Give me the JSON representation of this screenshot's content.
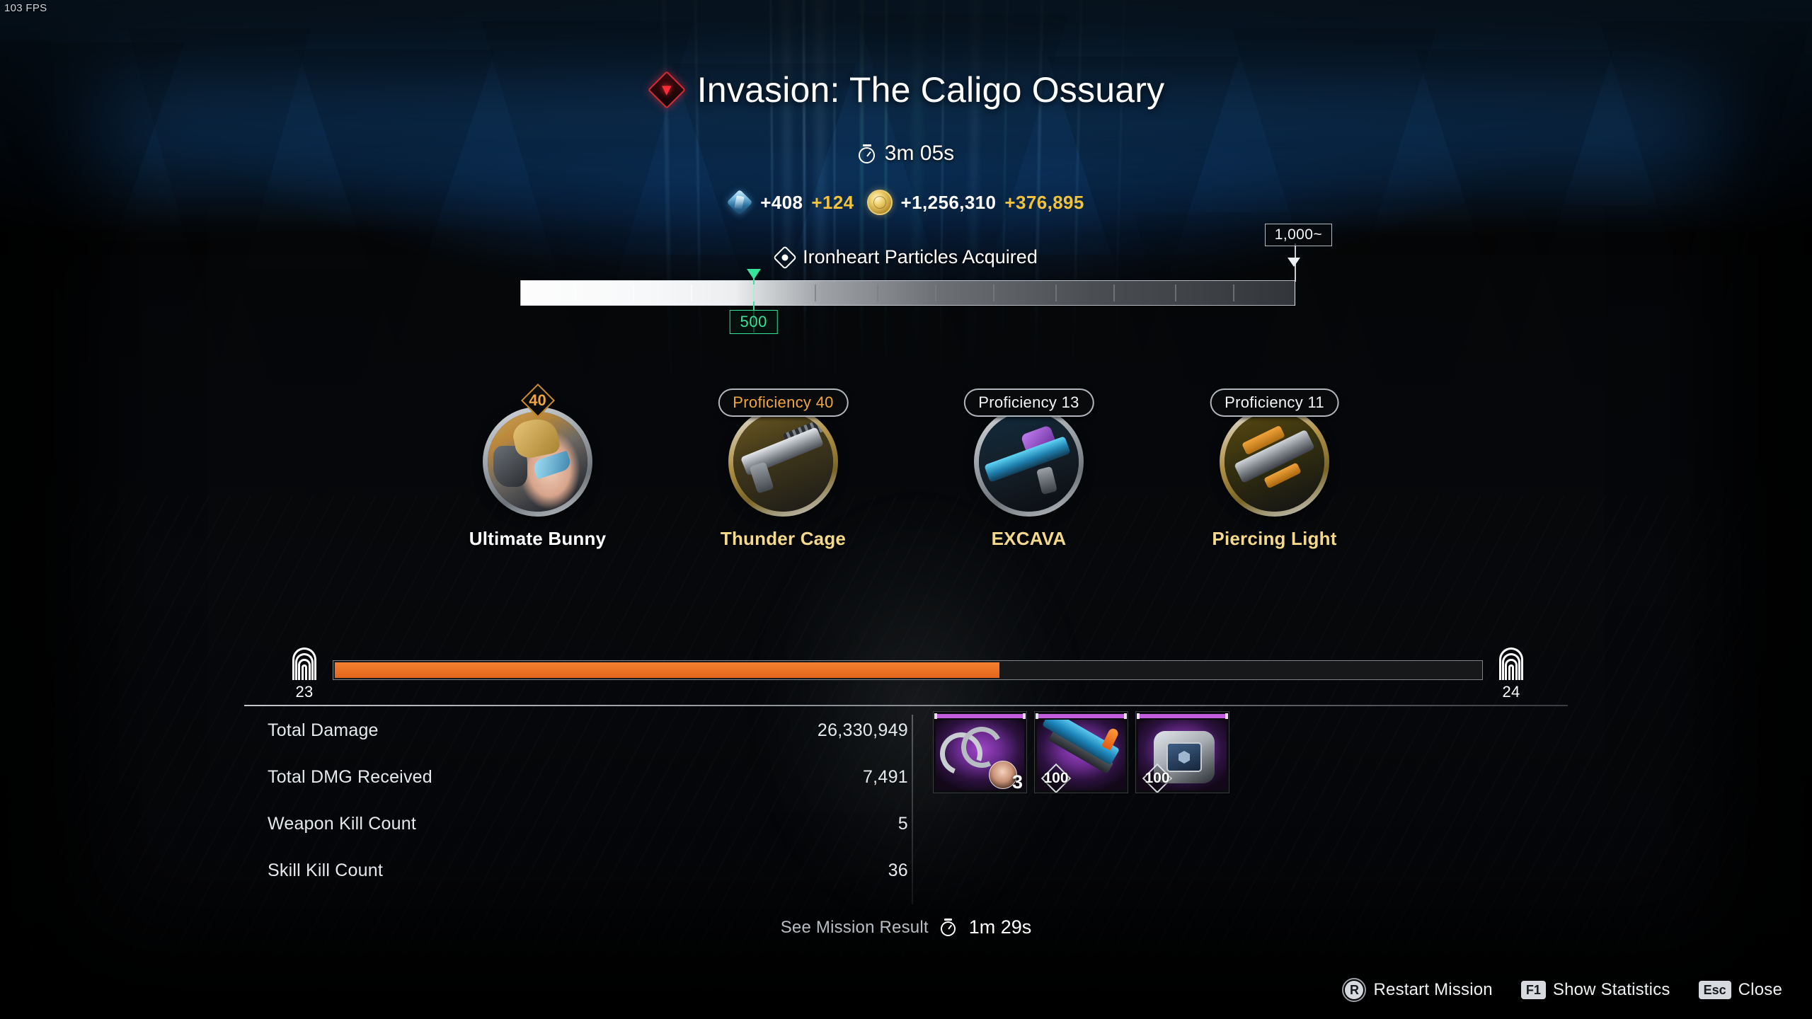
{
  "hud": {
    "fps": "103 FPS"
  },
  "header": {
    "emblem_icon": "invasion-diamond-icon",
    "title": "Invasion: The Caligo Ossuary",
    "clock_icon": "stopwatch-icon",
    "mission_time": "3m 05s"
  },
  "rewards": [
    {
      "icon": "kuiper-shard-icon",
      "amount": "+408",
      "bonus": "+124"
    },
    {
      "icon": "gold-coin-icon",
      "amount": "+1,256,310",
      "bonus": "+376,895"
    }
  ],
  "ironheart": {
    "icon": "ironheart-particle-icon",
    "label": "Ironheart Particles Acquired",
    "current_value": "500",
    "max_value": "1,000~",
    "fill_percent": 30,
    "ticks_percent": [
      7,
      14.5,
      22,
      30,
      38,
      46,
      53.5,
      61,
      69,
      76.5,
      84.5,
      92
    ]
  },
  "loadout": [
    {
      "name": "Ultimate Bunny",
      "name_color": "white",
      "badge_type": "diamond",
      "badge_value": "40",
      "ring": "silver",
      "art": "art-bunny",
      "slot": "descendant"
    },
    {
      "name": "Thunder Cage",
      "name_color": "gold",
      "badge_type": "pill",
      "badge_label": "Proficiency 40",
      "badge_color": "gold",
      "ring": "gold",
      "art": "art-gun1",
      "slot": "weapon-1"
    },
    {
      "name": "EXCAVA",
      "name_color": "gold",
      "badge_type": "pill",
      "badge_label": "Proficiency 13",
      "badge_color": "white",
      "ring": "silver",
      "art": "art-gun2",
      "slot": "weapon-2"
    },
    {
      "name": "Piercing Light",
      "name_color": "gold",
      "badge_type": "pill",
      "badge_label": "Proficiency 11",
      "badge_color": "white",
      "ring": "gold",
      "art": "art-gun3",
      "slot": "weapon-3"
    }
  ],
  "mastery": {
    "icon": "mastery-rank-icon",
    "current_rank": "23",
    "next_rank": "24",
    "fill_percent": 58
  },
  "stats": {
    "rows": [
      {
        "label": "Total Damage",
        "value": "26,330,949"
      },
      {
        "label": "Total DMG Received",
        "value": "7,491"
      },
      {
        "label": "Weapon Kill Count",
        "value": "5"
      },
      {
        "label": "Skill Kill Count",
        "value": "36"
      }
    ]
  },
  "items": [
    {
      "art": "it1",
      "rarity_color": "#c45ce0",
      "badge": "3",
      "badge_style": "plain",
      "icon": "enhancement-module-icon"
    },
    {
      "art": "it2",
      "rarity_color": "#c45ce0",
      "badge": "100",
      "badge_style": "diamond",
      "icon": "weapon-module-icon"
    },
    {
      "art": "it3",
      "rarity_color": "#c45ce0",
      "badge": "100",
      "badge_style": "diamond",
      "icon": "reactor-module-icon"
    }
  ],
  "see_result": {
    "label": "See Mission Result",
    "clock_icon": "stopwatch-icon",
    "countdown": "1m 29s"
  },
  "footer": {
    "actions": [
      {
        "key": "R",
        "key_style": "round",
        "label": "Restart Mission"
      },
      {
        "key": "F1",
        "key_style": "rect",
        "label": "Show Statistics"
      },
      {
        "key": "Esc",
        "key_style": "rect",
        "label": "Close"
      }
    ]
  },
  "colors": {
    "accent_orange": "#f3812f",
    "accent_green": "#35e39b",
    "accent_gold": "#f5d98a",
    "rarity_epic": "#c45ce0",
    "invasion_red": "#d92b33"
  }
}
